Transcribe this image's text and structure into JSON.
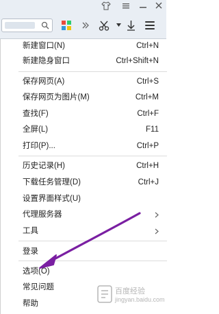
{
  "toolbar": {
    "icons": [
      "shirt-icon",
      "menu-lines-icon",
      "minimize-icon",
      "close-icon",
      "search-icon",
      "apps-grid-icon",
      "forward-icon",
      "scissors-icon",
      "dropdown-icon",
      "download-icon",
      "main-menu-icon"
    ],
    "accent_colors": {
      "arrow": "#7a1fa2",
      "apps_grid": [
        "#e84b3c",
        "#2ecc71",
        "#3498db",
        "#f1c40f"
      ]
    }
  },
  "menu": {
    "items": [
      {
        "label": "新建窗口(N)",
        "shortcut": "Ctrl+N"
      },
      {
        "label": "新建隐身窗口",
        "shortcut": "Ctrl+Shift+N"
      },
      {
        "label": "保存网页(A)",
        "shortcut": "Ctrl+S"
      },
      {
        "label": "保存网页为图片(M)",
        "shortcut": "Ctrl+M"
      },
      {
        "label": "查找(F)",
        "shortcut": "Ctrl+F"
      },
      {
        "label": "全屏(L)",
        "shortcut": "F11"
      },
      {
        "label": "打印(P)...",
        "shortcut": "Ctrl+P"
      },
      {
        "label": "历史记录(H)",
        "shortcut": "Ctrl+H"
      },
      {
        "label": "下载任务管理(D)",
        "shortcut": "Ctrl+J"
      },
      {
        "label": "设置界面样式(U)",
        "shortcut": ""
      },
      {
        "label": "代理服务器",
        "shortcut": ""
      },
      {
        "label": "工具",
        "shortcut": ""
      },
      {
        "label": "登录",
        "shortcut": ""
      },
      {
        "label": "选项(O)",
        "shortcut": ""
      },
      {
        "label": "常见问题",
        "shortcut": ""
      },
      {
        "label": "帮助",
        "shortcut": ""
      }
    ]
  },
  "watermark": {
    "line1": "百度经验",
    "line2": "jingyan.baidu.com"
  }
}
